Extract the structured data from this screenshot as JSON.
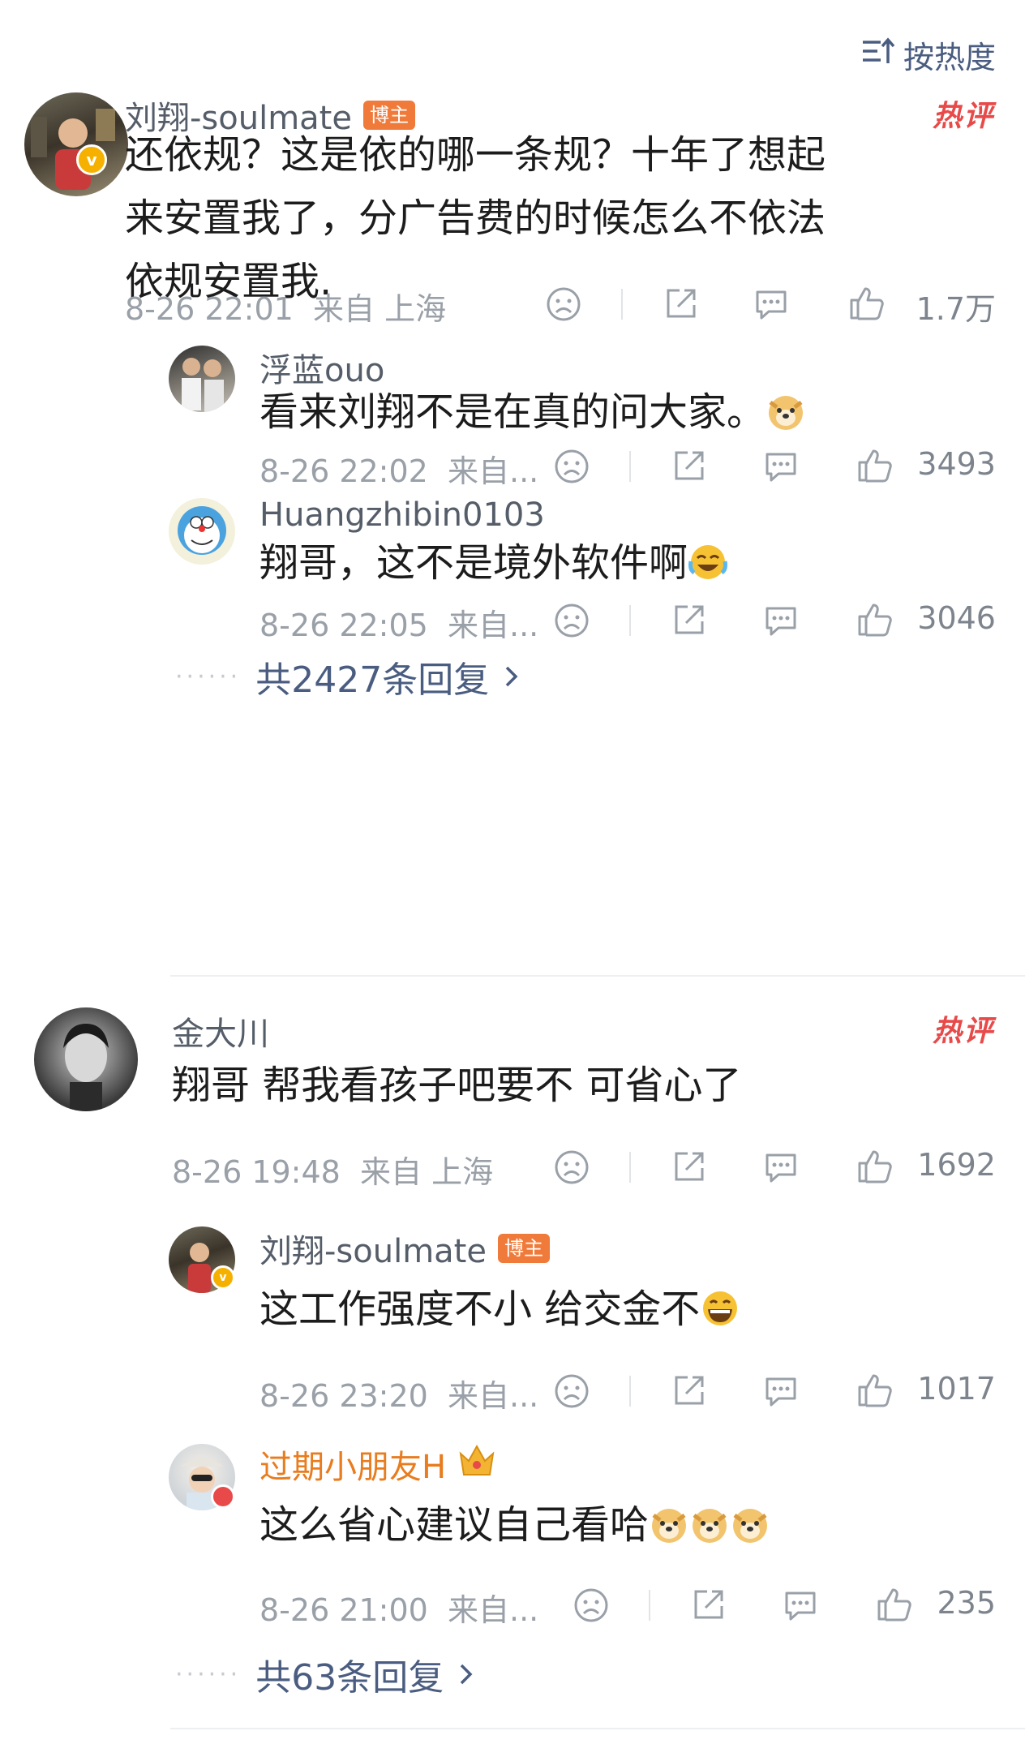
{
  "sort": {
    "label": "按热度"
  },
  "comments": [
    {
      "user": "刘翔-soulmate",
      "tag": "博主",
      "hot": "热评",
      "text_lines": [
        "还依规？这是依的哪一条规？十年了想起",
        "来安置我了，分广告费的时候怎么不依法",
        "依规安置我."
      ],
      "time": "8-26 22:01",
      "location": "来自 上海",
      "likes": "1.7万",
      "replies": [
        {
          "user": "浮蓝ouo",
          "text": "看来刘翔不是在真的问大家。",
          "emoji": [
            "doge"
          ],
          "time": "8-26 22:02",
          "location": "来自...",
          "likes": "3493"
        },
        {
          "user": "Huangzhibin0103",
          "text": "翔哥，这不是境外软件啊",
          "emoji": [
            "laugh-cry"
          ],
          "time": "8-26 22:05",
          "location": "来自...",
          "likes": "3046"
        }
      ],
      "more_replies": "共2427条回复"
    },
    {
      "user": "金大川",
      "hot": "热评",
      "text": "翔哥 帮我看孩子吧要不 可省心了",
      "time": "8-26 19:48",
      "location": "来自 上海",
      "likes": "1692",
      "replies": [
        {
          "user": "刘翔-soulmate",
          "tag": "博主",
          "text": "这工作强度不小 给交金不",
          "emoji": [
            "grin"
          ],
          "time": "8-26 23:20",
          "location": "来自...",
          "likes": "1017"
        },
        {
          "user": "过期小朋友H",
          "badge": "crown-icon",
          "text": "这么省心建议自己看哈",
          "emoji": [
            "doge",
            "doge",
            "doge"
          ],
          "time": "8-26 21:00",
          "location": "来自...",
          "likes": "235"
        }
      ],
      "more_replies": "共63条回复"
    }
  ],
  "colors": {
    "link": "#4a5d80",
    "hot": "#e84a4a",
    "tag": "#f07a3a",
    "vip_name": "#e87c1e"
  }
}
